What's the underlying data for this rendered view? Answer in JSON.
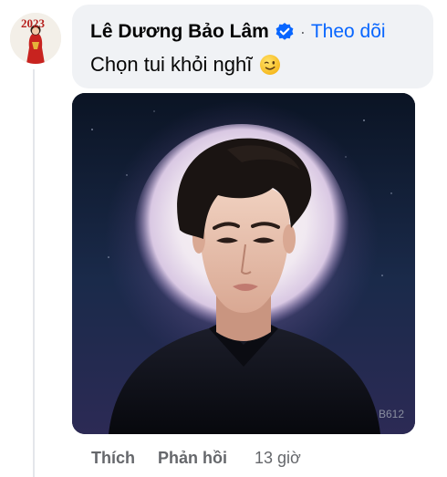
{
  "comment": {
    "author": "Lê Dương Bảo Lâm",
    "separator": "·",
    "follow_label": "Theo dõi",
    "text": "Chọn tui khỏi nghĩ",
    "emoji": "winking-face",
    "verified_icon": "verified-badge-icon",
    "attachment": {
      "watermark": "B612"
    },
    "actions": {
      "like_label": "Thích",
      "reply_label": "Phản hồi",
      "timestamp": "13 giờ"
    }
  },
  "avatar": {
    "badge_text": "2023"
  },
  "colors": {
    "bubble": "#f0f2f5",
    "link_blue": "#0866ff",
    "secondary_text": "#65676b",
    "verified": "#0866ff"
  }
}
